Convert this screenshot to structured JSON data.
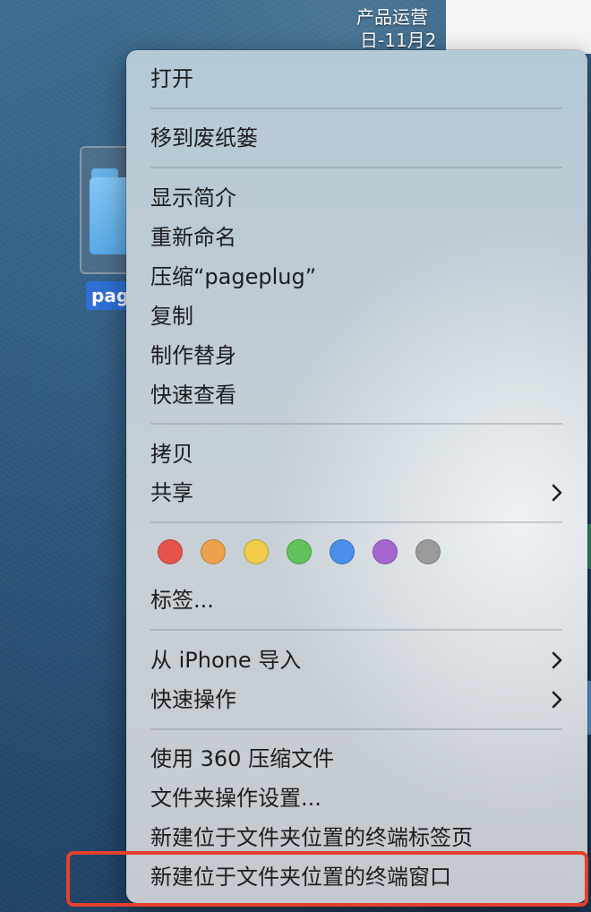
{
  "desktop": {
    "label_line1": "产品运营",
    "label_line2": "日-11月2",
    "selected_folder_name": "pag"
  },
  "context_menu": {
    "items": [
      {
        "label": "打开",
        "submenu": false
      },
      {
        "label": "移到废纸篓",
        "submenu": false
      },
      {
        "label": "显示简介",
        "submenu": false
      },
      {
        "label": "重新命名",
        "submenu": false
      },
      {
        "label": "压缩“pageplug”",
        "submenu": false
      },
      {
        "label": "复制",
        "submenu": false
      },
      {
        "label": "制作替身",
        "submenu": false
      },
      {
        "label": "快速查看",
        "submenu": false
      },
      {
        "label": "拷贝",
        "submenu": false
      },
      {
        "label": "共享",
        "submenu": true
      },
      {
        "label": "标签...",
        "submenu": false
      },
      {
        "label": "从 iPhone 导入",
        "submenu": true
      },
      {
        "label": "快速操作",
        "submenu": true
      },
      {
        "label": "使用 360 压缩文件",
        "submenu": false
      },
      {
        "label": "文件夹操作设置...",
        "submenu": false
      },
      {
        "label": "新建位于文件夹位置的终端标签页",
        "submenu": false
      },
      {
        "label": "新建位于文件夹位置的终端窗口",
        "submenu": false,
        "highlighted": true
      }
    ],
    "tag_colors": [
      {
        "name": "red",
        "color": "#e5534b"
      },
      {
        "name": "orange",
        "color": "#eda14b"
      },
      {
        "name": "yellow",
        "color": "#f0cc4a"
      },
      {
        "name": "green",
        "color": "#5fc25a"
      },
      {
        "name": "blue",
        "color": "#4a8ee8"
      },
      {
        "name": "purple",
        "color": "#a566d1"
      },
      {
        "name": "gray",
        "color": "#9a9a9c"
      }
    ]
  },
  "colors": {
    "highlight_border": "#e6402b",
    "selection_blue": "#2f6fd6"
  }
}
